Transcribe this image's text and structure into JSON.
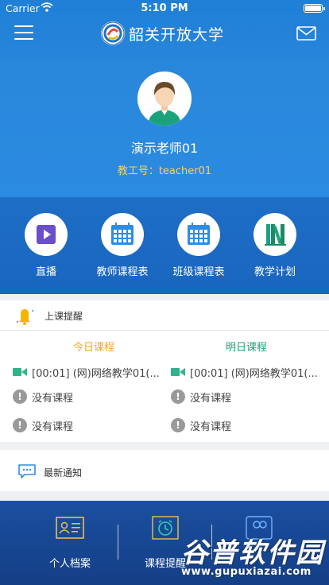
{
  "status": {
    "carrier": "Carrier",
    "time": "5:10 PM"
  },
  "app": {
    "title": "韶关开放大学"
  },
  "profile": {
    "name": "演示老师01",
    "id_label": "教工号：teacher01"
  },
  "quick_menu": [
    {
      "label": "直播",
      "icon": "play-icon"
    },
    {
      "label": "教师课程表",
      "icon": "calendar-icon"
    },
    {
      "label": "班级课程表",
      "icon": "calendar-icon"
    },
    {
      "label": "教学计划",
      "icon": "books-icon"
    }
  ],
  "reminder": {
    "title": "上课提醒",
    "today": {
      "title": "今日课程",
      "color": "#f5a623",
      "rows": [
        "[00:01] (网)网络教学01(...",
        "没有课程",
        "没有课程"
      ]
    },
    "tomorrow": {
      "title": "明日课程",
      "color": "#1aa37a",
      "rows": [
        "[00:01] (网)网络教学01(...",
        "没有课程",
        "没有课程"
      ]
    }
  },
  "notice": {
    "title": "最新通知"
  },
  "bottom_tabs": [
    {
      "label": "个人档案"
    },
    {
      "label": "课程提醒"
    }
  ],
  "watermark": {
    "big": "谷普软件园",
    "small": "www.gupuxiazai.com"
  },
  "colors": {
    "primary": "#2a88dc",
    "accent": "#ffd24a",
    "bottom": "#1b4fa0"
  }
}
